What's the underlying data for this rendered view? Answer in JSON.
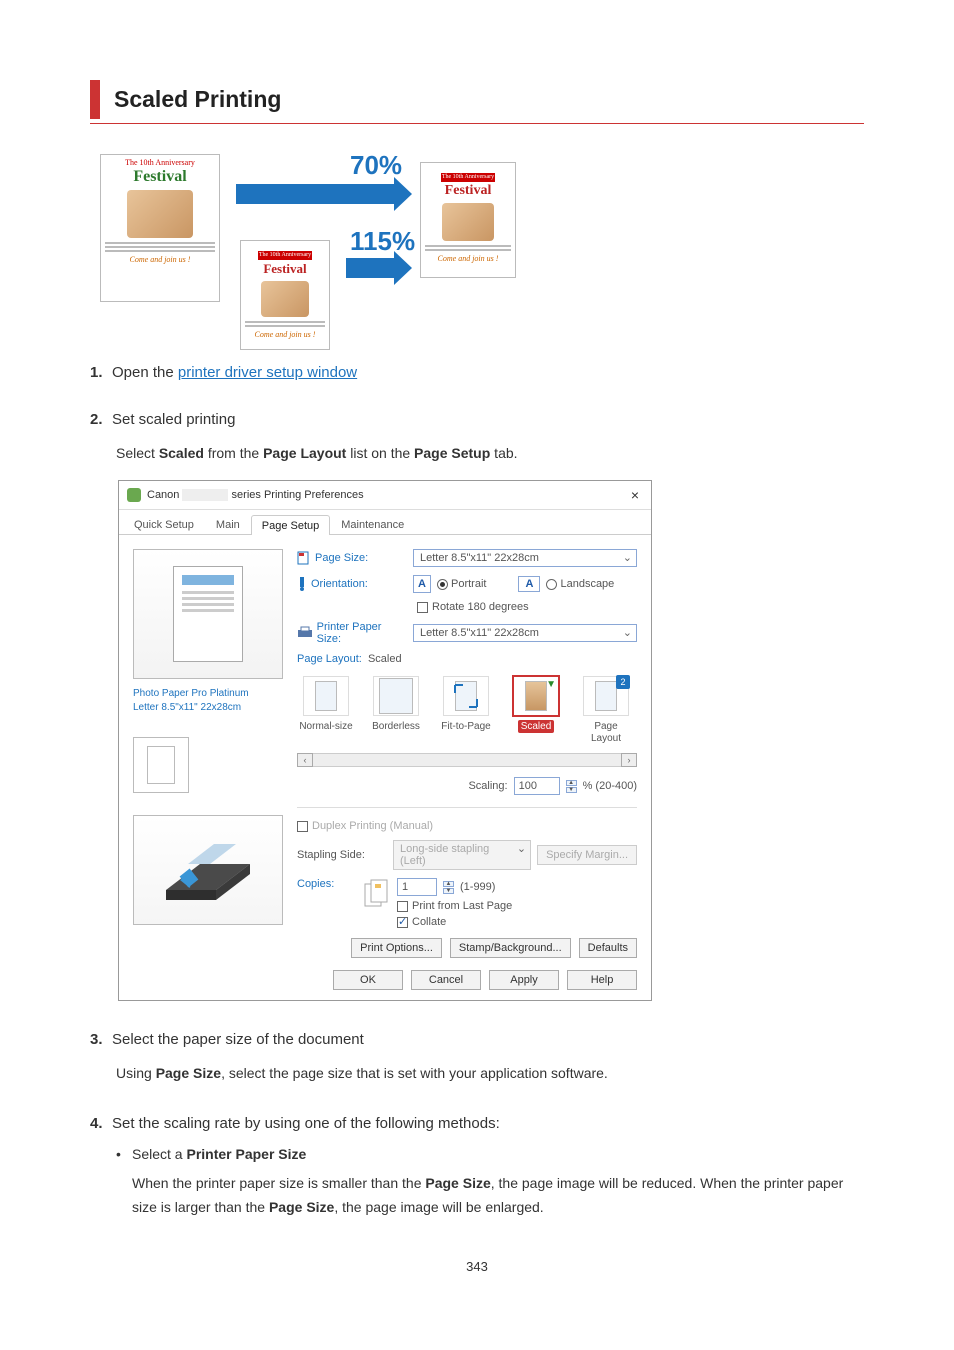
{
  "title": "Scaled Printing",
  "illustration": {
    "pct70": "70%",
    "pct115": "115%",
    "poster_header": "The 10th Anniversary",
    "poster_brand": "Festival",
    "poster_join": "Come and join us !"
  },
  "steps": [
    {
      "num": "1.",
      "title_pre": "Open the ",
      "link": "printer driver setup window"
    },
    {
      "num": "2.",
      "title": "Set scaled printing",
      "body_parts": [
        "Select ",
        "Scaled",
        " from the ",
        "Page Layout",
        " list on the ",
        "Page Setup",
        " tab."
      ]
    },
    {
      "num": "3.",
      "title": "Select the paper size of the document",
      "body_parts": [
        "Using ",
        "Page Size",
        ", select the page size that is set with your application software."
      ]
    },
    {
      "num": "4.",
      "title": "Set the scaling rate by using one of the following methods:"
    }
  ],
  "bullet": {
    "lead": "Select a ",
    "strong": "Printer Paper Size",
    "body": [
      "When the printer paper size is smaller than the ",
      "Page Size",
      ", the page image will be reduced. When the printer paper size is larger than the ",
      "Page Size",
      ", the page image will be enlarged."
    ]
  },
  "dialog": {
    "title_prefix": "Canon",
    "title_suffix": "series Printing Preferences",
    "close": "×",
    "tabs": [
      "Quick Setup",
      "Main",
      "Page Setup",
      "Maintenance"
    ],
    "active_tab": 2,
    "preview_caption1": "Photo Paper Pro Platinum",
    "preview_caption2": "Letter 8.5\"x11\" 22x28cm",
    "page_size_label": "Page Size:",
    "page_size_value": "Letter 8.5\"x11\" 22x28cm",
    "orientation_label": "Orientation:",
    "portrait": "Portrait",
    "landscape": "Landscape",
    "rotate180": "Rotate 180 degrees",
    "printer_paper_label": "Printer Paper Size:",
    "printer_paper_value": "Letter 8.5\"x11\" 22x28cm",
    "page_layout_label": "Page Layout:",
    "page_layout_value": "Scaled",
    "layouts": [
      "Normal-size",
      "Borderless",
      "Fit-to-Page",
      "Scaled",
      "Page Layout"
    ],
    "scaling_label": "Scaling:",
    "scaling_value": "100",
    "scaling_suffix": "% (20-400)",
    "duplex": "Duplex Printing (Manual)",
    "stapling_label": "Stapling Side:",
    "stapling_value": "Long-side stapling (Left)",
    "specify_margin": "Specify Margin...",
    "copies_label": "Copies:",
    "copies_value": "1",
    "copies_range": "(1-999)",
    "print_last": "Print from Last Page",
    "collate": "Collate",
    "print_options": "Print Options...",
    "stamp_bg": "Stamp/Background...",
    "defaults": "Defaults",
    "ok": "OK",
    "cancel": "Cancel",
    "apply": "Apply",
    "help": "Help"
  },
  "page_number": "343"
}
